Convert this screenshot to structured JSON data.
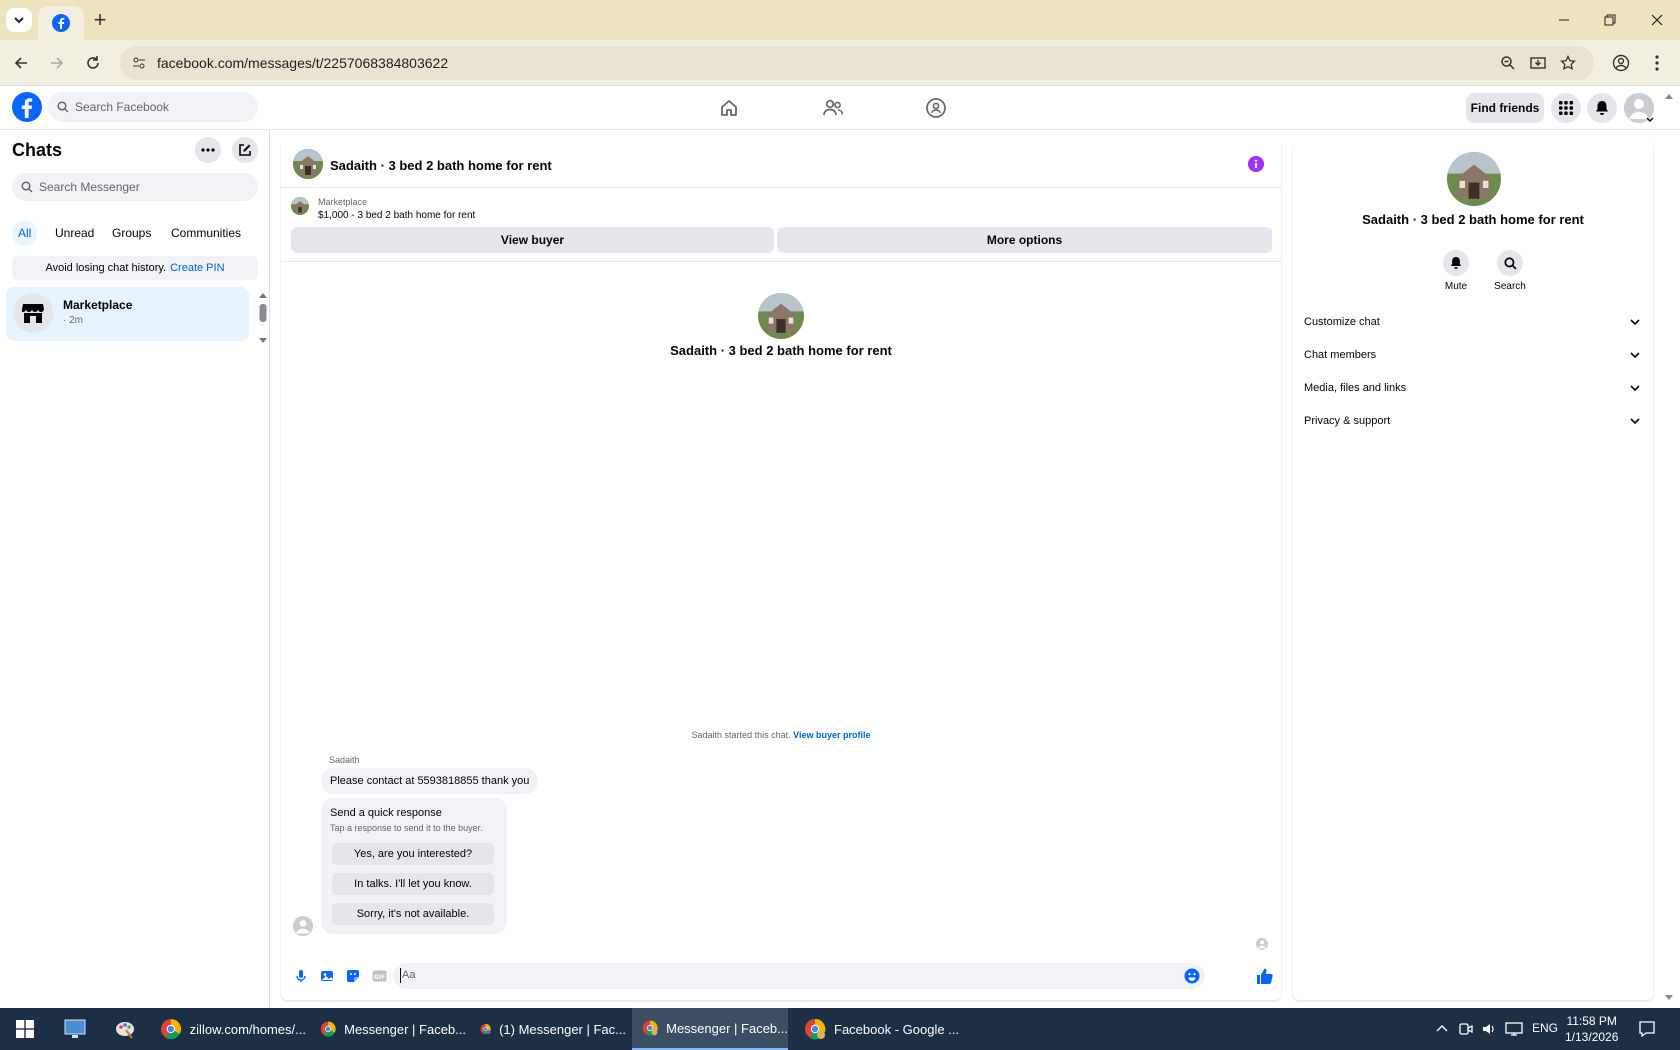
{
  "browser": {
    "url": "facebook.com/messages/t/2257068384803622",
    "new_tab_glyph": "+"
  },
  "fb_header": {
    "search_placeholder": "Search Facebook",
    "find_friends_label": "Find friends"
  },
  "left_panel": {
    "title": "Chats",
    "search_placeholder": "Search Messenger",
    "filters": [
      "All",
      "Unread",
      "Groups",
      "Communities"
    ],
    "pin_notice": "Avoid losing chat history.",
    "pin_link": "Create PIN",
    "chat_item": {
      "name": "Marketplace",
      "time": "· 2m"
    }
  },
  "conversation": {
    "title": "Sadaith · 3 bed 2 bath home for rent",
    "marketplace_label": "Marketplace",
    "listing": "$1,000 - 3 bed 2 bath home for rent",
    "view_buyer_label": "View buyer",
    "more_options_label": "More options",
    "center_title": "Sadaith · 3 bed 2 bath home for rent",
    "started_text": "Sadaith started this chat.",
    "view_buyer_profile": "View buyer profile",
    "sender_name": "Sadaith",
    "message": "Please contact at 5593818855 thank you",
    "quick_response": {
      "title": "Send a quick response",
      "subtitle": "Tap a response to send it to the buyer.",
      "options": [
        "Yes, are you interested?",
        "In talks. I'll let you know.",
        "Sorry, it's not available."
      ]
    },
    "composer_placeholder": "Aa"
  },
  "right_panel": {
    "title": "Sadaith · 3 bed 2 bath home for rent",
    "mute_label": "Mute",
    "search_label": "Search",
    "sections": [
      "Customize chat",
      "Chat members",
      "Media, files and links",
      "Privacy & support"
    ]
  },
  "taskbar": {
    "apps": [
      "zillow.com/homes/...",
      "Messenger | Faceb...",
      "(1) Messenger | Fac...",
      "Messenger | Faceb...",
      "Facebook - Google ..."
    ],
    "lang": "ENG",
    "time": "11:58 PM",
    "date": "1/13/2026"
  },
  "colors": {
    "fb_blue": "#0866ff",
    "link_blue": "#0064d1",
    "info_purple": "#a033ff",
    "tabstrip": "#ebe4bf",
    "taskbar": "#1c2f45"
  }
}
